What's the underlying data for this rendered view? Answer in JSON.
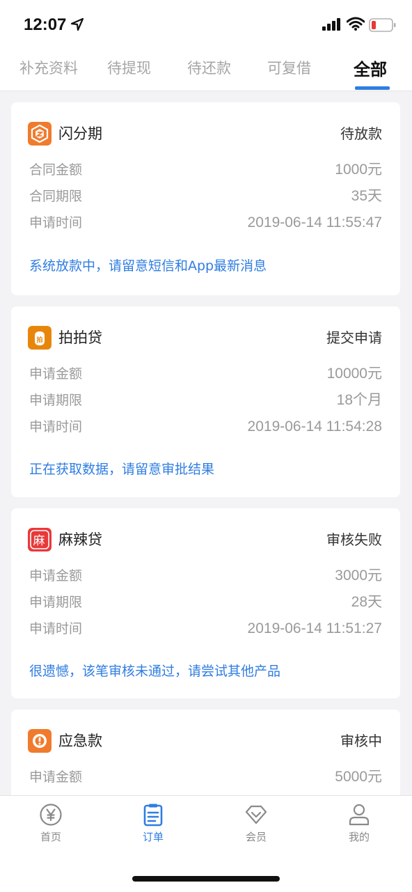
{
  "status_bar": {
    "time": "12:07"
  },
  "tabs": [
    {
      "label": "补充资料",
      "active": false
    },
    {
      "label": "待提现",
      "active": false
    },
    {
      "label": "待还款",
      "active": false
    },
    {
      "label": "可复借",
      "active": false
    },
    {
      "label": "全部",
      "active": true
    }
  ],
  "orders": [
    {
      "name": "闪分期",
      "status": "待放款",
      "logo_color": "#f07b2d",
      "logo_icon": "flash-logo-icon",
      "rows": [
        {
          "label": "合同金额",
          "value": "1000元"
        },
        {
          "label": "合同期限",
          "value": "35天"
        },
        {
          "label": "申请时间",
          "value": "2019-06-14 11:55:47"
        }
      ],
      "message": "系统放款中，请留意短信和App最新消息"
    },
    {
      "name": "拍拍贷",
      "status": "提交申请",
      "logo_color": "#e8860b",
      "logo_icon": "ppdai-logo-icon",
      "rows": [
        {
          "label": "申请金额",
          "value": "10000元"
        },
        {
          "label": "申请期限",
          "value": "18个月"
        },
        {
          "label": "申请时间",
          "value": "2019-06-14 11:54:28"
        }
      ],
      "message": "正在获取数据，请留意审批结果"
    },
    {
      "name": "麻辣贷",
      "status": "审核失败",
      "logo_color": "#e8393a",
      "logo_icon": "mala-logo-icon",
      "logo_text": "麻",
      "rows": [
        {
          "label": "申请金额",
          "value": "3000元"
        },
        {
          "label": "申请期限",
          "value": "28天"
        },
        {
          "label": "申请时间",
          "value": "2019-06-14 11:51:27"
        }
      ],
      "message": "很遗憾，该笔审核未通过，请尝试其他产品"
    },
    {
      "name": "应急款",
      "status": "审核中",
      "logo_color": "#f07b2d",
      "logo_icon": "emergency-logo-icon",
      "rows": [
        {
          "label": "申请金额",
          "value": "5000元"
        }
      ],
      "message": ""
    }
  ],
  "tabbar": [
    {
      "label": "首页",
      "icon": "yen-icon",
      "active": false
    },
    {
      "label": "订单",
      "icon": "clipboard-icon",
      "active": true
    },
    {
      "label": "会员",
      "icon": "diamond-icon",
      "active": false
    },
    {
      "label": "我的",
      "icon": "person-icon",
      "active": false
    }
  ],
  "colors": {
    "accent": "#2f7de1",
    "battery_low": "#e8393a"
  }
}
